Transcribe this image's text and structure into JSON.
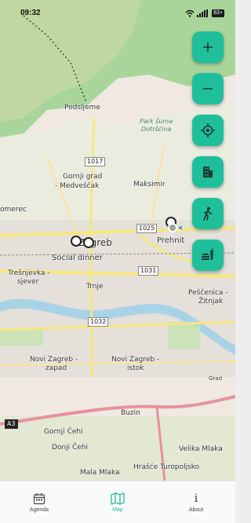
{
  "status_bar": {
    "time": "09:32",
    "battery": "83+"
  },
  "map": {
    "places": {
      "podsljeme": "Podsljeme",
      "park_suma": "Park šuma",
      "dotrscina": "Dotršćina",
      "maksimir": "Maksimir",
      "gornji_grad": "Gornji grad",
      "medvescak": "- Medveščak",
      "zagreb": "Zagreb",
      "social_dinner": "Social dinner",
      "prehnit": "Prehnit",
      "tresnjevka": "Trešnjevka -",
      "sjever": "sjever",
      "trnje": "Trnje",
      "pescenica": "Peščenica -",
      "zitnjak": "Žitnjak",
      "novi_zagreb_zapad_1": "Novi Zagreb -",
      "novi_zagreb_zapad_2": "zapad",
      "novi_zagreb_istok_1": "Novi Zagreb -",
      "novi_zagreb_istok_2": "istok",
      "buzin": "Buzin",
      "gornji_cehi": "Gornji Čehi",
      "donji_cehi": "Donji Čehi",
      "velika_mlaka": "Velika Mlaka",
      "mala_mlaka": "Mala Mlaka",
      "hrasce": "Hrašće Turopoljsko",
      "omerec": "omerec",
      "gradska": "Grad"
    },
    "road_shields": [
      "1017",
      "1025",
      "1031",
      "1032",
      "A3"
    ]
  },
  "controls": {
    "zoom_in": "plus-icon",
    "zoom_out": "minus-icon",
    "locate": "crosshair-icon",
    "buildings": "building-icon",
    "walk": "walking-icon",
    "food": "food-icon",
    "accent": "#1fbf9c"
  },
  "nav": {
    "agenda": "Agenda",
    "map": "Map",
    "about": "About",
    "about_icon_glyph": "i",
    "active_color": "#1fbf9c"
  }
}
